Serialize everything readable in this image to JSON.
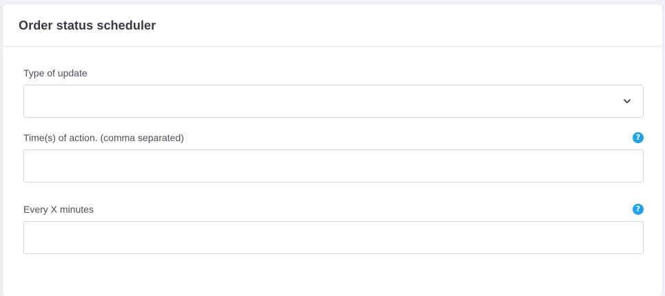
{
  "card": {
    "title": "Order status scheduler"
  },
  "fields": {
    "type_of_update": {
      "label": "Type of update",
      "value": "",
      "icon": "chevron-down-icon"
    },
    "times_of_action": {
      "label": "Time(s) of action. (comma separated)",
      "value": "",
      "help_icon": "?"
    },
    "every_x_minutes": {
      "label": "Every X minutes",
      "value": "",
      "help_icon": "?"
    }
  },
  "colors": {
    "help_icon_bg": "#1fa3e6",
    "border": "#d3d8dd",
    "title_text": "#363a41"
  }
}
